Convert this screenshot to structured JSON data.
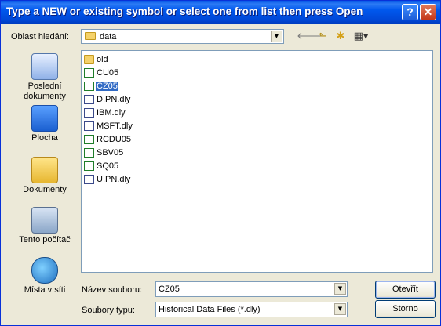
{
  "window": {
    "title": "Type a NEW or existing symbol or select one from list then press Open",
    "help_glyph": "?",
    "close_glyph": "✕"
  },
  "lookin": {
    "label": "Oblast hledání:",
    "value": "data"
  },
  "toolbar": {
    "back_glyph": "🡐",
    "up_glyph": "⬑",
    "newfolder_glyph": "✱",
    "view_glyph": "▦▾"
  },
  "places": [
    {
      "label": "Poslední dokumenty",
      "icon": "recent-documents-icon"
    },
    {
      "label": "Plocha",
      "icon": "desktop-icon"
    },
    {
      "label": "Dokumenty",
      "icon": "documents-folder-icon"
    },
    {
      "label": "Tento počítač",
      "icon": "computer-icon"
    },
    {
      "label": "Místa v síti",
      "icon": "network-places-icon"
    }
  ],
  "files": [
    {
      "name": "old",
      "type": "folder"
    },
    {
      "name": "CU05",
      "type": "xls"
    },
    {
      "name": "CZ05",
      "type": "xls",
      "selected": true
    },
    {
      "name": "D.PN.dly",
      "type": "dly"
    },
    {
      "name": "IBM.dly",
      "type": "dly"
    },
    {
      "name": "MSFT.dly",
      "type": "dly"
    },
    {
      "name": "RCDU05",
      "type": "xls"
    },
    {
      "name": "SBV05",
      "type": "xls"
    },
    {
      "name": "SQ05",
      "type": "xls"
    },
    {
      "name": "U.PN.dly",
      "type": "dly"
    }
  ],
  "filename": {
    "label": "Název souboru:",
    "value": "CZ05"
  },
  "filetype": {
    "label": "Soubory typu:",
    "value": "Historical Data Files (*.dly)"
  },
  "buttons": {
    "open": "Otevřít",
    "cancel": "Storno"
  },
  "colors": {
    "titlebar": "#0058ee",
    "selection": "#316ac5",
    "dialog_bg": "#ece9d8"
  }
}
